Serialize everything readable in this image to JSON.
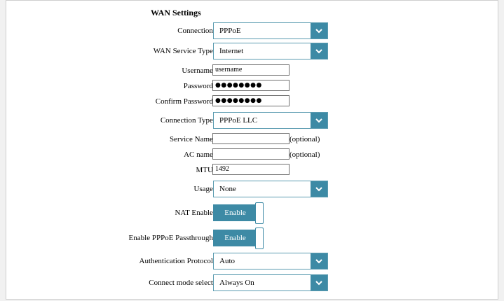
{
  "section_title": "WAN Settings",
  "fields": {
    "connection": {
      "label": "Connection:",
      "value": "PPPoE"
    },
    "wan_service_type": {
      "label": "WAN Service Type:",
      "value": "Internet"
    },
    "username": {
      "label": "Username:",
      "value": "username"
    },
    "password": {
      "label": "Password:",
      "value": "●●●●●●●●"
    },
    "confirm_password": {
      "label": "Confirm Password:",
      "value": "●●●●●●●●"
    },
    "connection_type": {
      "label": "Connection Type:",
      "value": "PPPoE LLC"
    },
    "service_name": {
      "label": "Service Name:",
      "value": "",
      "hint": "(optional)"
    },
    "ac_name": {
      "label": "AC name:",
      "value": "",
      "hint": "(optional)"
    },
    "mtu": {
      "label": "MTU:",
      "value": "1492"
    },
    "usage": {
      "label": "Usage:",
      "value": "None"
    },
    "nat_enable": {
      "label": "NAT Enable:",
      "button": "Enable"
    },
    "pppoe_passthrough": {
      "label": "Enable PPPoE Passthrough:",
      "button": "Enable"
    },
    "auth_protocol": {
      "label": "Authentication Protocol:",
      "value": "Auto"
    },
    "connect_mode": {
      "label": "Connect mode select:",
      "value": "Always On"
    }
  },
  "icons": {
    "dropdown": "chevron-down-icon"
  },
  "colors": {
    "accent": "#3d8aa5"
  }
}
